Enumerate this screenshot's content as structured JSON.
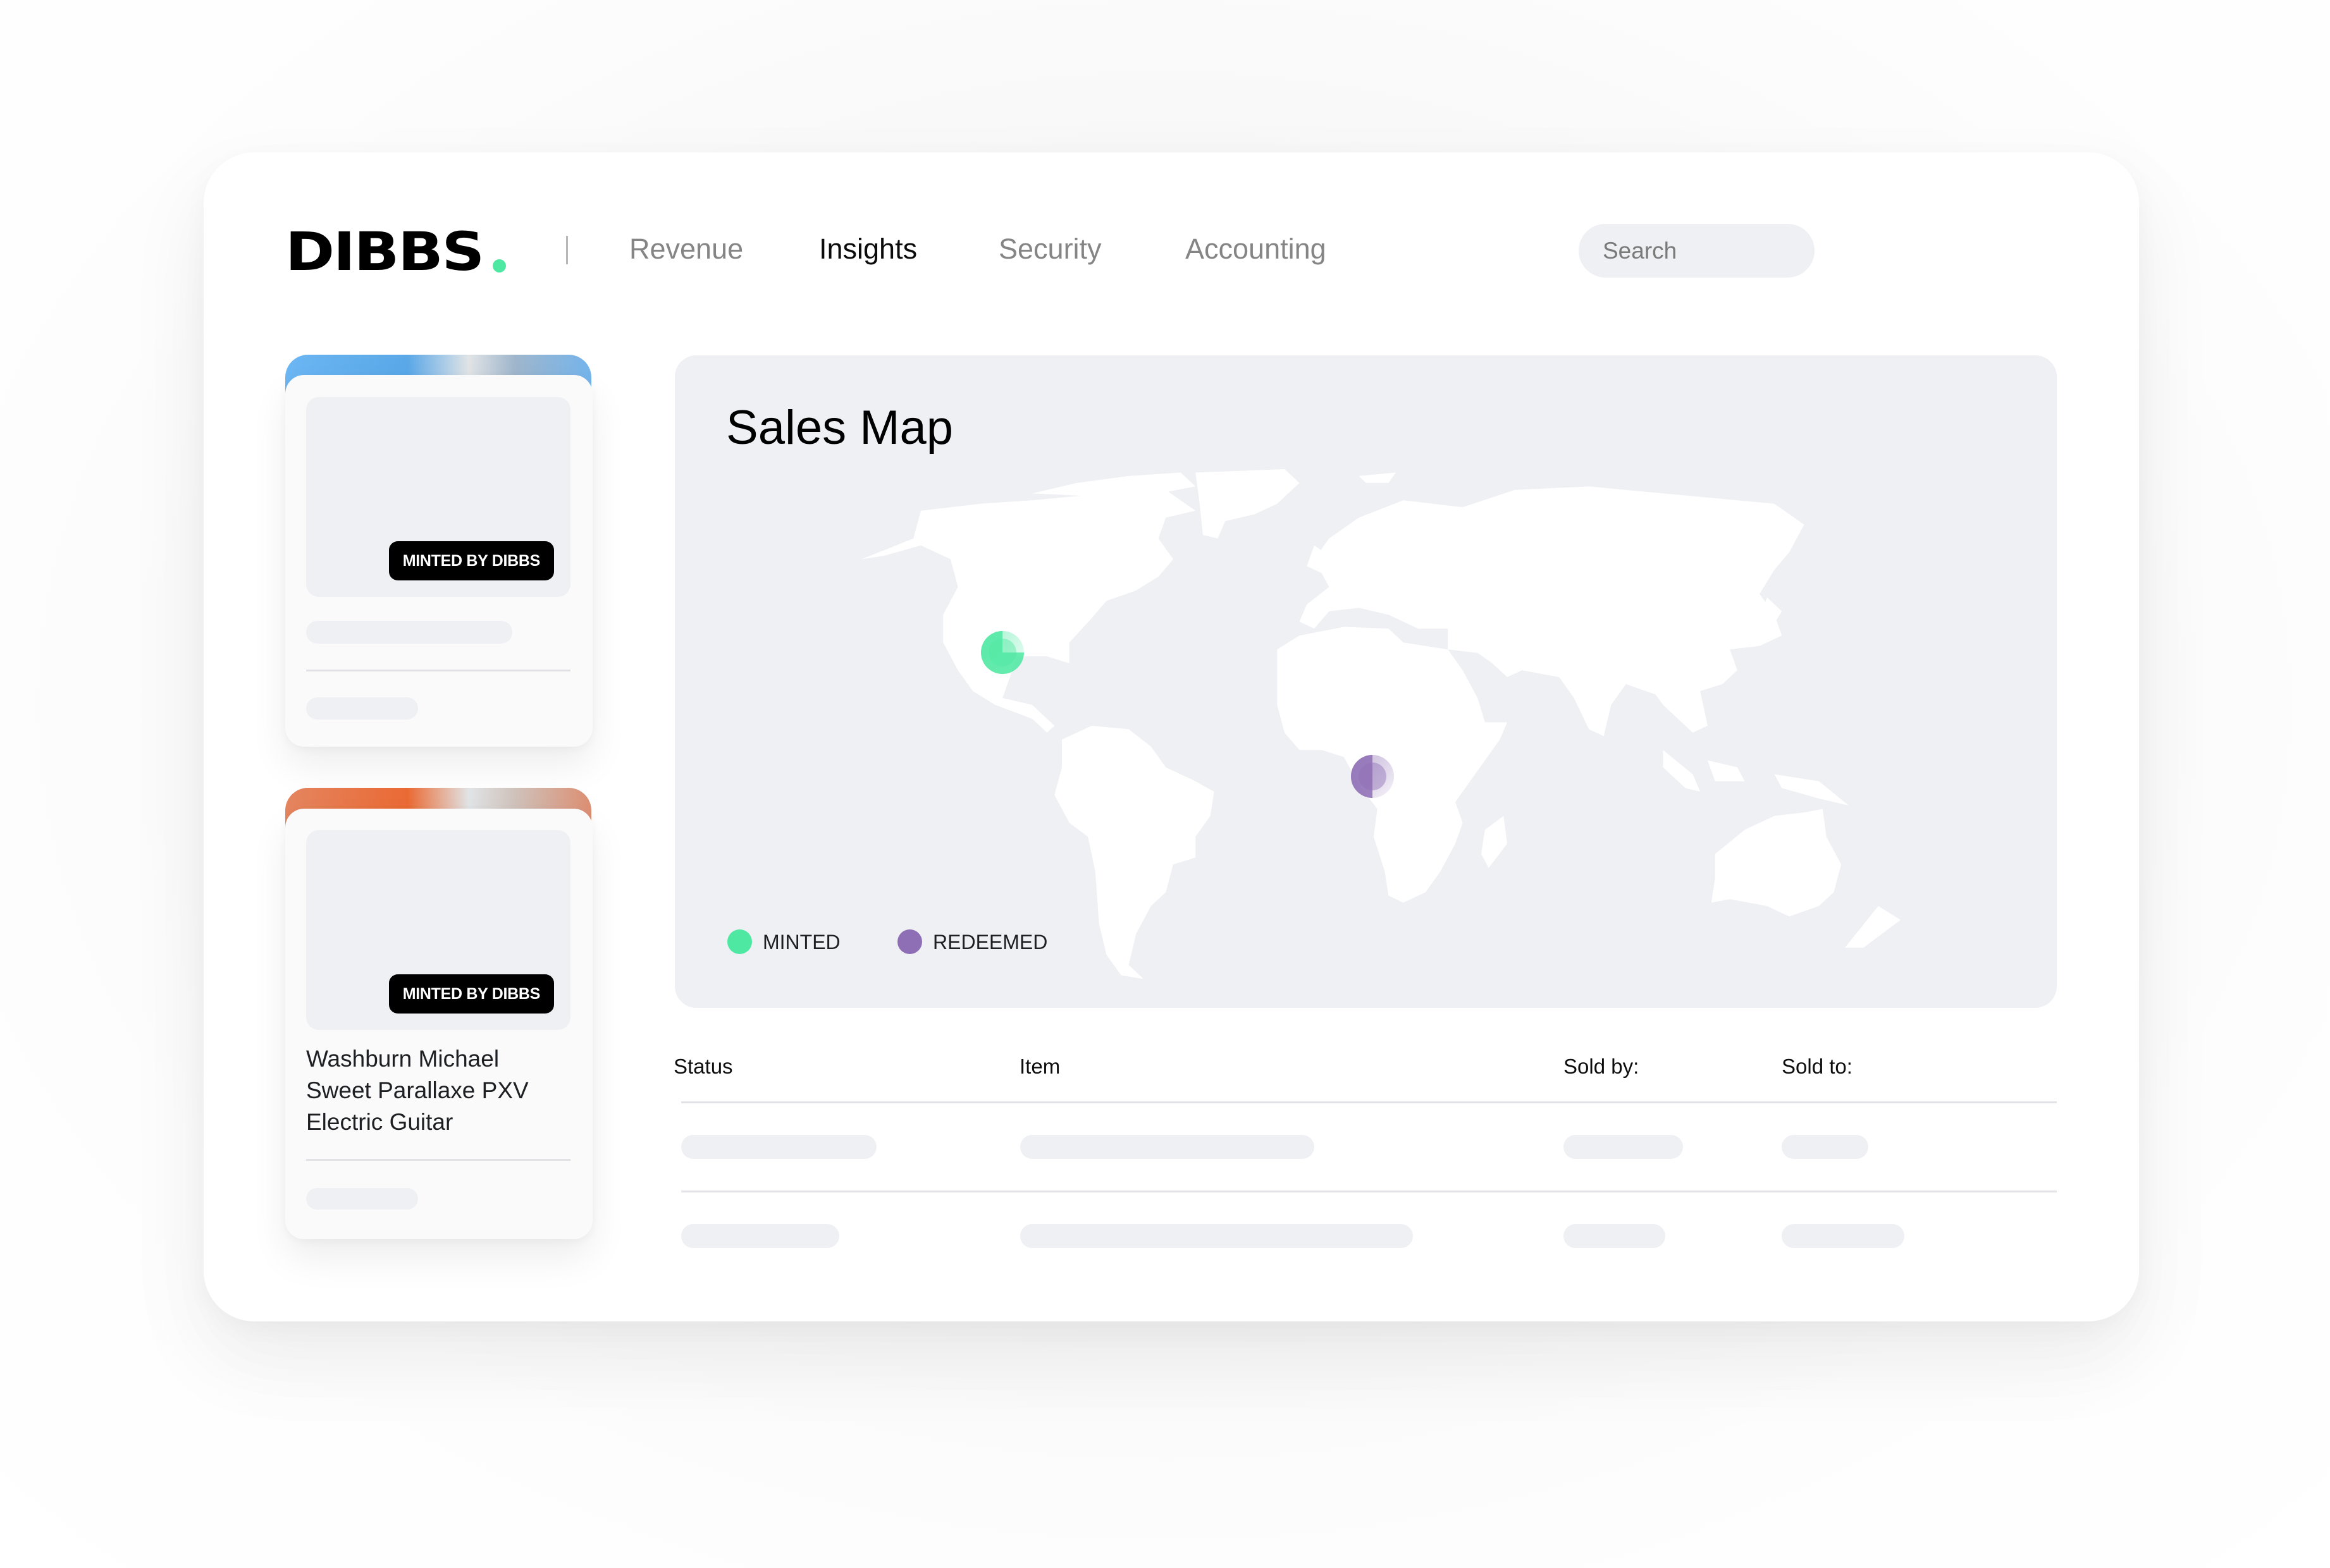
{
  "brand": {
    "name": "DIBBS",
    "dot_color": "#4fe8a2"
  },
  "nav": {
    "items": [
      {
        "label": "Revenue",
        "active": false
      },
      {
        "label": "Insights",
        "active": true
      },
      {
        "label": "Security",
        "active": false
      },
      {
        "label": "Accounting",
        "active": false
      }
    ]
  },
  "search": {
    "placeholder": "Search",
    "value": ""
  },
  "product_cards": [
    {
      "badge": "MINTED BY DIBBS",
      "title": "",
      "tab_gradient": [
        "#6bb6f3",
        "#5aa8e8",
        "#e1e4e6",
        "#9fb6cc",
        "#74b4ec"
      ],
      "loading": true
    },
    {
      "badge": "MINTED BY DIBBS",
      "title_lines": [
        "Washburn Michael",
        "Sweet Parallaxe PXV",
        "Electric Guitar"
      ],
      "tab_gradient": [
        "#e48560",
        "#ea6a34",
        "#e1e4e6",
        "#cfc2bb",
        "#dc8e72"
      ],
      "loading": false
    }
  ],
  "sales_map": {
    "title": "Sales Map",
    "legend": [
      {
        "label": "MINTED",
        "color": "#4fe8a2"
      },
      {
        "label": "REDEEMED",
        "color": "#8e6fb5"
      }
    ],
    "markers": [
      {
        "type": "MINTED",
        "location": "Southwestern United States",
        "color": "#4fe8a2",
        "progress": 0.75
      },
      {
        "type": "REDEEMED",
        "location": "Gulf of Guinea, West Africa",
        "color": "#8e6fb5",
        "progress": 0.5
      }
    ]
  },
  "table": {
    "columns": [
      "Status",
      "Item",
      "Sold by:",
      "Sold to:"
    ],
    "rows": [
      {
        "status": "",
        "item": "",
        "sold_by": "",
        "sold_to": "",
        "loading": true
      },
      {
        "status": "",
        "item": "",
        "sold_by": "",
        "sold_to": "",
        "loading": true
      }
    ]
  }
}
